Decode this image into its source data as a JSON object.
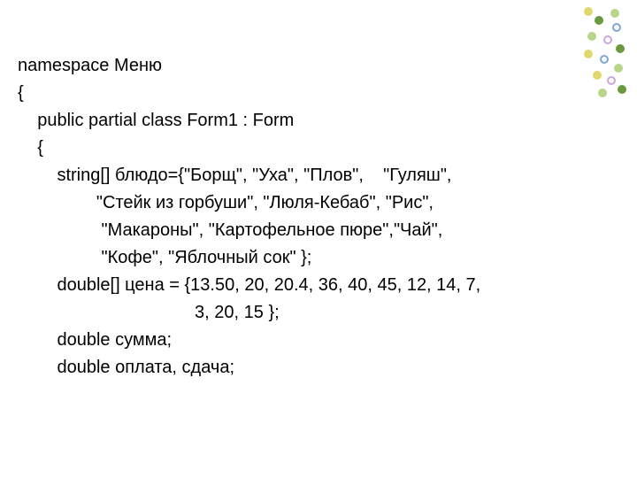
{
  "code": {
    "l1": "namespace Меню",
    "l2": "{",
    "l3": "    public partial class Form1 : Form",
    "l4": "    {",
    "l5": "        string[] блюдо={\"Борщ\", \"Уха\", \"Плов\",    \"Гуляш\",",
    "l6": "                \"Стейк из горбуши\", \"Люля-Кебаб\", \"Рис\",",
    "l7": "                 \"Макароны\", \"Картофельное пюре\",\"Чай\",",
    "l8": "                 \"Кофе\", \"Яблочный сок\" };",
    "l9": "        double[] цена = {13.50, 20, 20.4, 36, 40, 45, 12, 14, 7,",
    "l10": "                                    3, 20, 15 };",
    "l11": "        double сумма;",
    "l12": "        double оплата, сдача;"
  }
}
